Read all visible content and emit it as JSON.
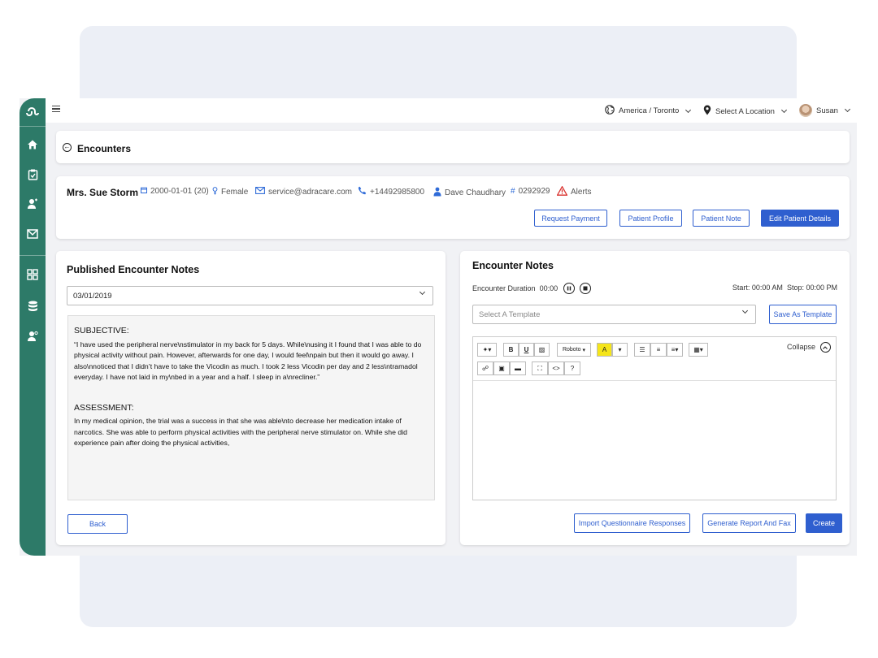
{
  "topbar": {
    "timezone": "America / Toronto",
    "location": "Select A Location",
    "user": "Susan"
  },
  "breadcrumb": {
    "title": "Encounters"
  },
  "patient": {
    "name": "Mrs. Sue Storm",
    "dob": "2000-01-01 (20)",
    "gender": "Female",
    "email": "service@adracare.com",
    "phone": "+14492985800",
    "provider": "Dave Chaudhary",
    "id": "0292929",
    "alerts": "Alerts",
    "buttons": {
      "request_payment": "Request Payment",
      "patient_profile": "Patient Profile",
      "patient_note": "Patient Note",
      "edit_details": "Edit Patient Details"
    }
  },
  "published": {
    "title": "Published Encounter Notes",
    "date_value": "03/01/2019",
    "subjective_heading": "SUBJECTIVE:",
    "subjective_text": "“I have used the peripheral nerve\\nstimulator in my back for 5 days.  While\\nusing it I found that I  was able to do physical  activity without pain.  However, afterwards for one day, I would feel\\npain  but then it would go away.  I also\\nnoticed that I didn’t have to take the Vicodin as much.   I took 2 less Vicodin per day and 2 less\\ntramadol everyday.  I have not laid in my\\nbed in a year  and a half.  I sleep in a\\nrecliner.”",
    "assessment_heading": "ASSESSMENT:",
    "assessment_text": "In my medical opinion, the trial was a success in that she was able\\nto decrease her medication  intake of narcotics. She was able to perform physical activities with the peripheral nerve  stimulator on.  While she did experience pain after doing the physical activities,",
    "back_label": "Back"
  },
  "encounter": {
    "title": "Encounter Notes",
    "duration_label": "Encounter Duration",
    "duration_value": "00:00",
    "start_label": "Start: 00:00 AM",
    "stop_label": "Stop: 00:00 PM",
    "template_placeholder": "Select A Template",
    "save_template": "Save As Template",
    "collapse": "Collapse",
    "font_name": "Roboto",
    "buttons": {
      "import": "Import Questionnaire Responses",
      "generate": "Generate Report And Fax",
      "create": "Create"
    }
  },
  "colors": {
    "sidebar": "#2d7a68",
    "primary": "#2f5fcf",
    "highlight": "#f5e51a",
    "alert": "#d9302c"
  }
}
